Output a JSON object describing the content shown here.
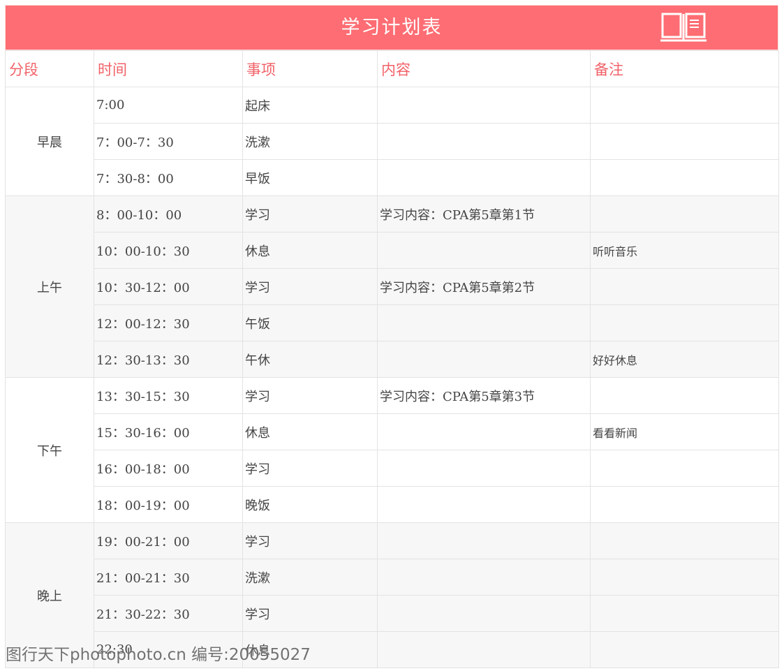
{
  "title": "学习计划表",
  "icon": "book-icon",
  "colors": {
    "header_bg": "#fd6d73",
    "header_text": "#f16268",
    "band_bg": "#f7f7f7"
  },
  "headers": [
    "分段",
    "时间",
    "事项",
    "内容",
    "备注"
  ],
  "segments": [
    {
      "name": "早晨",
      "rows": [
        {
          "time": "7:00",
          "item": "起床",
          "content": "",
          "note": ""
        },
        {
          "time": "7：00-7：30",
          "item": "洗漱",
          "content": "",
          "note": ""
        },
        {
          "time": "7：30-8：00",
          "item": "早饭",
          "content": "",
          "note": ""
        }
      ]
    },
    {
      "name": "上午",
      "rows": [
        {
          "time": "8：00-10：00",
          "item": "学习",
          "content": "学习内容：CPA第5章第1节",
          "note": ""
        },
        {
          "time": "10：00-10：30",
          "item": "休息",
          "content": "",
          "note": "听听音乐"
        },
        {
          "time": "10：30-12：00",
          "item": "学习",
          "content": "学习内容：CPA第5章第2节",
          "note": ""
        },
        {
          "time": "12：00-12：30",
          "item": "午饭",
          "content": "",
          "note": ""
        },
        {
          "time": "12：30-13：30",
          "item": "午休",
          "content": "",
          "note": "好好休息"
        }
      ]
    },
    {
      "name": "下午",
      "rows": [
        {
          "time": "13：30-15：30",
          "item": "学习",
          "content": "学习内容：CPA第5章第3节",
          "note": ""
        },
        {
          "time": "15：30-16：00",
          "item": "休息",
          "content": "",
          "note": "看看新闻"
        },
        {
          "time": "16：00-18：00",
          "item": "学习",
          "content": "",
          "note": ""
        },
        {
          "time": "18：00-19：00",
          "item": "晚饭",
          "content": "",
          "note": ""
        }
      ]
    },
    {
      "name": "晚上",
      "rows": [
        {
          "time": "19：00-21：00",
          "item": "学习",
          "content": "",
          "note": ""
        },
        {
          "time": "21：00-21：30",
          "item": "洗漱",
          "content": "",
          "note": ""
        },
        {
          "time": "21：30-22：30",
          "item": "学习",
          "content": "",
          "note": ""
        },
        {
          "time": "22:30",
          "item": "休息",
          "content": "",
          "note": ""
        }
      ]
    }
  ],
  "watermark": "图行天下photophoto.cn 编号:20055027"
}
